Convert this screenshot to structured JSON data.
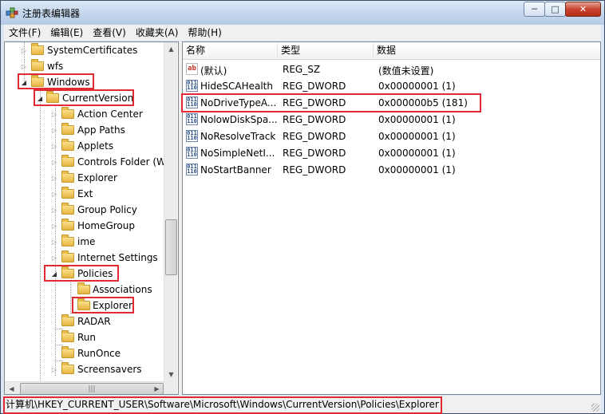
{
  "window": {
    "title": "注册表编辑器",
    "controls": {
      "minimize": "─",
      "maximize": "□",
      "close": "✕"
    }
  },
  "menu": [
    "文件(F)",
    "编辑(E)",
    "查看(V)",
    "收藏夹(A)",
    "帮助(H)"
  ],
  "tree": {
    "items": [
      {
        "label": "SystemCertificates",
        "toggle": "▷"
      },
      {
        "label": "wfs",
        "toggle": "▷"
      },
      {
        "label": "Windows",
        "toggle": "◢"
      },
      {
        "label": "CurrentVersion",
        "toggle": "◢"
      },
      {
        "label": "Action Center",
        "toggle": "▷"
      },
      {
        "label": "App Paths",
        "toggle": "▷"
      },
      {
        "label": "Applets",
        "toggle": "▷"
      },
      {
        "label": "Controls Folder (W",
        "toggle": "▷"
      },
      {
        "label": "Explorer",
        "toggle": "▷"
      },
      {
        "label": "Ext",
        "toggle": "▷"
      },
      {
        "label": "Group Policy",
        "toggle": "▷"
      },
      {
        "label": "HomeGroup",
        "toggle": "▷"
      },
      {
        "label": "ime",
        "toggle": "▷"
      },
      {
        "label": "Internet Settings",
        "toggle": "▷"
      },
      {
        "label": "Policies",
        "toggle": "◢"
      },
      {
        "label": "Associations",
        "toggle": ""
      },
      {
        "label": "Explorer",
        "toggle": ""
      },
      {
        "label": "RADAR",
        "toggle": ""
      },
      {
        "label": "Run",
        "toggle": ""
      },
      {
        "label": "RunOnce",
        "toggle": ""
      },
      {
        "label": "Screensavers",
        "toggle": "▷"
      }
    ],
    "scroll": {
      "up": "▲",
      "down": "▼",
      "left": "◀",
      "right": "▶",
      "grip": "|||"
    }
  },
  "list": {
    "columns": [
      "名称",
      "类型",
      "数据"
    ],
    "rows": [
      {
        "icon": "string-value-icon",
        "name": "(默认)",
        "type": "REG_SZ",
        "data": "(数值未设置)"
      },
      {
        "icon": "dword-value-icon",
        "name": "HideSCAHealth",
        "type": "REG_DWORD",
        "data": "0x00000001 (1)"
      },
      {
        "icon": "dword-value-icon",
        "name": "NoDriveTypeA...",
        "type": "REG_DWORD",
        "data": "0x000000b5 (181)"
      },
      {
        "icon": "dword-value-icon",
        "name": "NolowDiskSpa...",
        "type": "REG_DWORD",
        "data": "0x00000001 (1)"
      },
      {
        "icon": "dword-value-icon",
        "name": "NoResolveTrack",
        "type": "REG_DWORD",
        "data": "0x00000001 (1)"
      },
      {
        "icon": "dword-value-icon",
        "name": "NoSimpleNetI...",
        "type": "REG_DWORD",
        "data": "0x00000001 (1)"
      },
      {
        "icon": "dword-value-icon",
        "name": "NoStartBanner",
        "type": "REG_DWORD",
        "data": "0x00000001 (1)"
      }
    ],
    "icon_text": {
      "string": "ab",
      "dword": "011 110"
    }
  },
  "status": {
    "path": "计算机\\HKEY_CURRENT_USER\\Software\\Microsoft\\Windows\\CurrentVersion\\Policies\\Explorer"
  },
  "colors": {
    "highlight": "#e22a35",
    "titlebar": "#c3d6ec",
    "folder": "#e6b440"
  }
}
